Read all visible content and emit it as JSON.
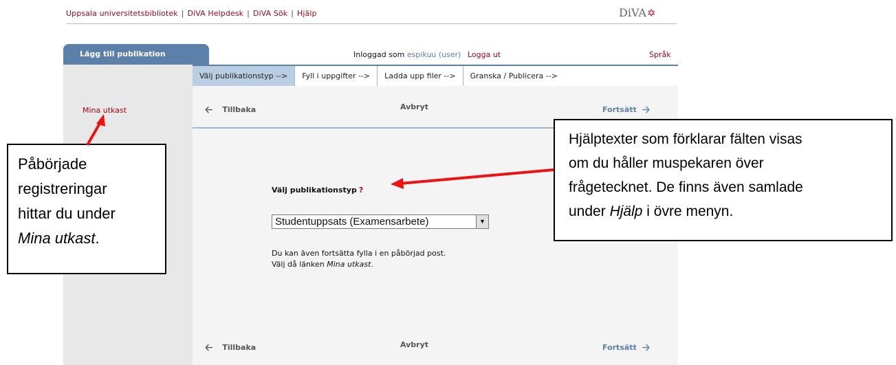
{
  "topnav": {
    "links": [
      "Uppsala universitetsbibliotek",
      "DiVA Helpdesk",
      "DiVA Sök",
      "Hjälp"
    ],
    "logo_text": "DiVA",
    "logo_star": "✡"
  },
  "sidebar": {
    "tab_label": "Lägg till publikation",
    "drafts_link": "Mina utkast"
  },
  "header": {
    "logged_in_prefix": "Inloggad som",
    "user": "espikuu (user)",
    "logout": "Logga ut",
    "language": "Språk"
  },
  "steps": [
    {
      "label": "Välj publikationstyp -->",
      "active": true
    },
    {
      "label": "Fyll i uppgifter -->",
      "active": false
    },
    {
      "label": "Ladda upp filer -->",
      "active": false
    },
    {
      "label": "Granska / Publicera -->",
      "active": false
    }
  ],
  "nav": {
    "back": "Tillbaka",
    "cancel": "Avbryt",
    "next": "Fortsätt"
  },
  "form": {
    "label": "Välj publikationstyp",
    "help_marker": "?",
    "select_value": "Studentuppsats (Examensarbete)",
    "hint_line1": "Du kan även fortsätta fylla i en påbörjad post.",
    "hint_line2_prefix": "Välj då länken",
    "hint_line2_em": "Mina utkast",
    "hint_line2_suffix": "."
  },
  "annotations": {
    "left": {
      "line1": "Påbörjade",
      "line2": "registreringar",
      "line3": "hittar du under",
      "line4_em": "Mina utkast",
      "line4_suffix": "."
    },
    "right": {
      "line1": "Hjälptexter som förklarar fälten visas",
      "line2": "om du håller muspekaren över",
      "line3": "frågetecknet. De finns även samlade",
      "line4_prefix": "under",
      "line4_em": "Hjälp",
      "line4_suffix": "i övre menyn."
    }
  },
  "colors": {
    "accent_red": "#b00018",
    "accent_blue": "#5b80a9",
    "arrow_red": "#ee1111"
  },
  "icons": {
    "back": "arrow-left-icon",
    "next": "arrow-right-icon",
    "dropdown": "dropdown-arrow-icon",
    "logo": "star-of-david-icon"
  }
}
